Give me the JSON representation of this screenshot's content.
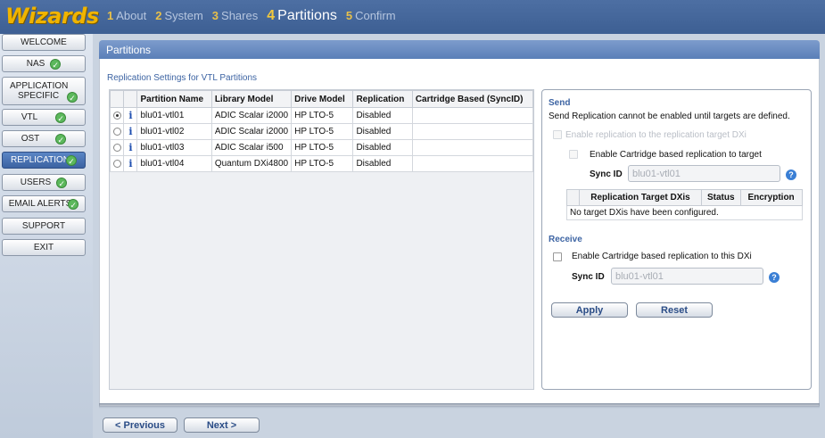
{
  "app": {
    "logo": "Wizards"
  },
  "steps": [
    {
      "num": "1",
      "label": "About"
    },
    {
      "num": "2",
      "label": "System"
    },
    {
      "num": "3",
      "label": "Shares"
    },
    {
      "num": "4",
      "label": "Partitions"
    },
    {
      "num": "5",
      "label": "Confirm"
    }
  ],
  "sidebar": {
    "items": [
      {
        "label": "WELCOME",
        "checked": false,
        "active": false
      },
      {
        "label": "NAS",
        "checked": true,
        "active": false
      },
      {
        "label": "APPLICATION SPECIFIC",
        "checked": true,
        "active": false
      },
      {
        "label": "VTL",
        "checked": true,
        "active": false
      },
      {
        "label": "OST",
        "checked": true,
        "active": false
      },
      {
        "label": "REPLICATION",
        "checked": true,
        "active": true
      },
      {
        "label": "USERS",
        "checked": true,
        "active": false
      },
      {
        "label": "EMAIL ALERTS",
        "checked": true,
        "active": false
      },
      {
        "label": "SUPPORT",
        "checked": false,
        "active": false
      },
      {
        "label": "EXIT",
        "checked": false,
        "active": false
      }
    ]
  },
  "panel": {
    "title": "Partitions",
    "section_label": "Replication Settings for VTL Partitions"
  },
  "partitions_table": {
    "headers": [
      "Partition Name",
      "Library Model",
      "Drive Model",
      "Replication",
      "Cartridge Based (SyncID)"
    ],
    "rows": [
      {
        "selected": true,
        "name": "blu01-vtl01",
        "library": "ADIC Scalar i2000",
        "drive": "HP LTO-5",
        "replication": "Disabled",
        "cartridge": ""
      },
      {
        "selected": false,
        "name": "blu01-vtl02",
        "library": "ADIC Scalar i2000",
        "drive": "HP LTO-5",
        "replication": "Disabled",
        "cartridge": ""
      },
      {
        "selected": false,
        "name": "blu01-vtl03",
        "library": "ADIC Scalar i500",
        "drive": "HP LTO-5",
        "replication": "Disabled",
        "cartridge": ""
      },
      {
        "selected": false,
        "name": "blu01-vtl04",
        "library": "Quantum DXi4800",
        "drive": "HP LTO-5",
        "replication": "Disabled",
        "cartridge": ""
      }
    ]
  },
  "send": {
    "heading": "Send",
    "notice": "Send Replication cannot be enabled until targets are defined.",
    "enable_label": "Enable replication to the replication target DXi",
    "cartridge_label": "Enable Cartridge based replication to target",
    "sync_id_label": "Sync ID",
    "sync_id_value": "blu01-vtl01",
    "targets_headers": [
      "Replication Target DXis",
      "Status",
      "Encryption"
    ],
    "targets_empty": "No target DXis have been configured."
  },
  "receive": {
    "heading": "Receive",
    "cartridge_label": "Enable Cartridge based replication to this DXi",
    "sync_id_label": "Sync ID",
    "sync_id_value": "blu01-vtl01"
  },
  "actions": {
    "apply": "Apply",
    "reset": "Reset"
  },
  "footer": {
    "previous": "< Previous",
    "next": "Next >"
  },
  "colors": {
    "header": "#4d6fa3",
    "logo": "#f0b400",
    "accent": "#3d64a3",
    "active_nav": "#4a74b5"
  }
}
